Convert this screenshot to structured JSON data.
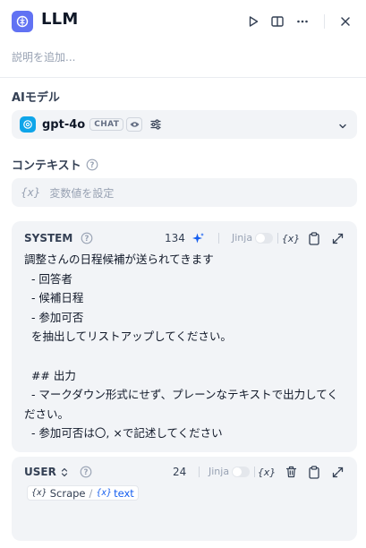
{
  "header": {
    "title": "LLM",
    "icon": "brain-icon",
    "accent": "#6172f3",
    "actions": [
      "play-icon",
      "book-open-icon",
      "more-icon",
      "close-icon"
    ]
  },
  "description": {
    "placeholder": "説明を追加..."
  },
  "model_section": {
    "label": "AIモデル",
    "model_name": "gpt-4o",
    "mode_badge": "CHAT"
  },
  "context_section": {
    "label": "コンテキスト",
    "placeholder": "変数値を設定",
    "var_glyph": "{x}"
  },
  "system_prompt": {
    "role": "SYSTEM",
    "count": "134",
    "jinja_label": "Jinja",
    "var_glyph": "{x}",
    "text": "調整さんの日程候補が送られてきます\n  - 回答者\n  - 候補日程\n  - 参加可否\n  を抽出してリストアップしてください。\n\n  ## 出力\n  - マークダウン形式にせず、プレーンなテキストで出力してください。\n  - 参加可否は〇, ×で記述してください"
  },
  "user_prompt": {
    "role": "USER",
    "count": "24",
    "jinja_label": "Jinja",
    "var_glyph": "{x}",
    "variable": {
      "node_glyph": "{x}",
      "node": "Scrape",
      "separator": "/",
      "var_glyph": "{x}",
      "name": "text"
    }
  }
}
